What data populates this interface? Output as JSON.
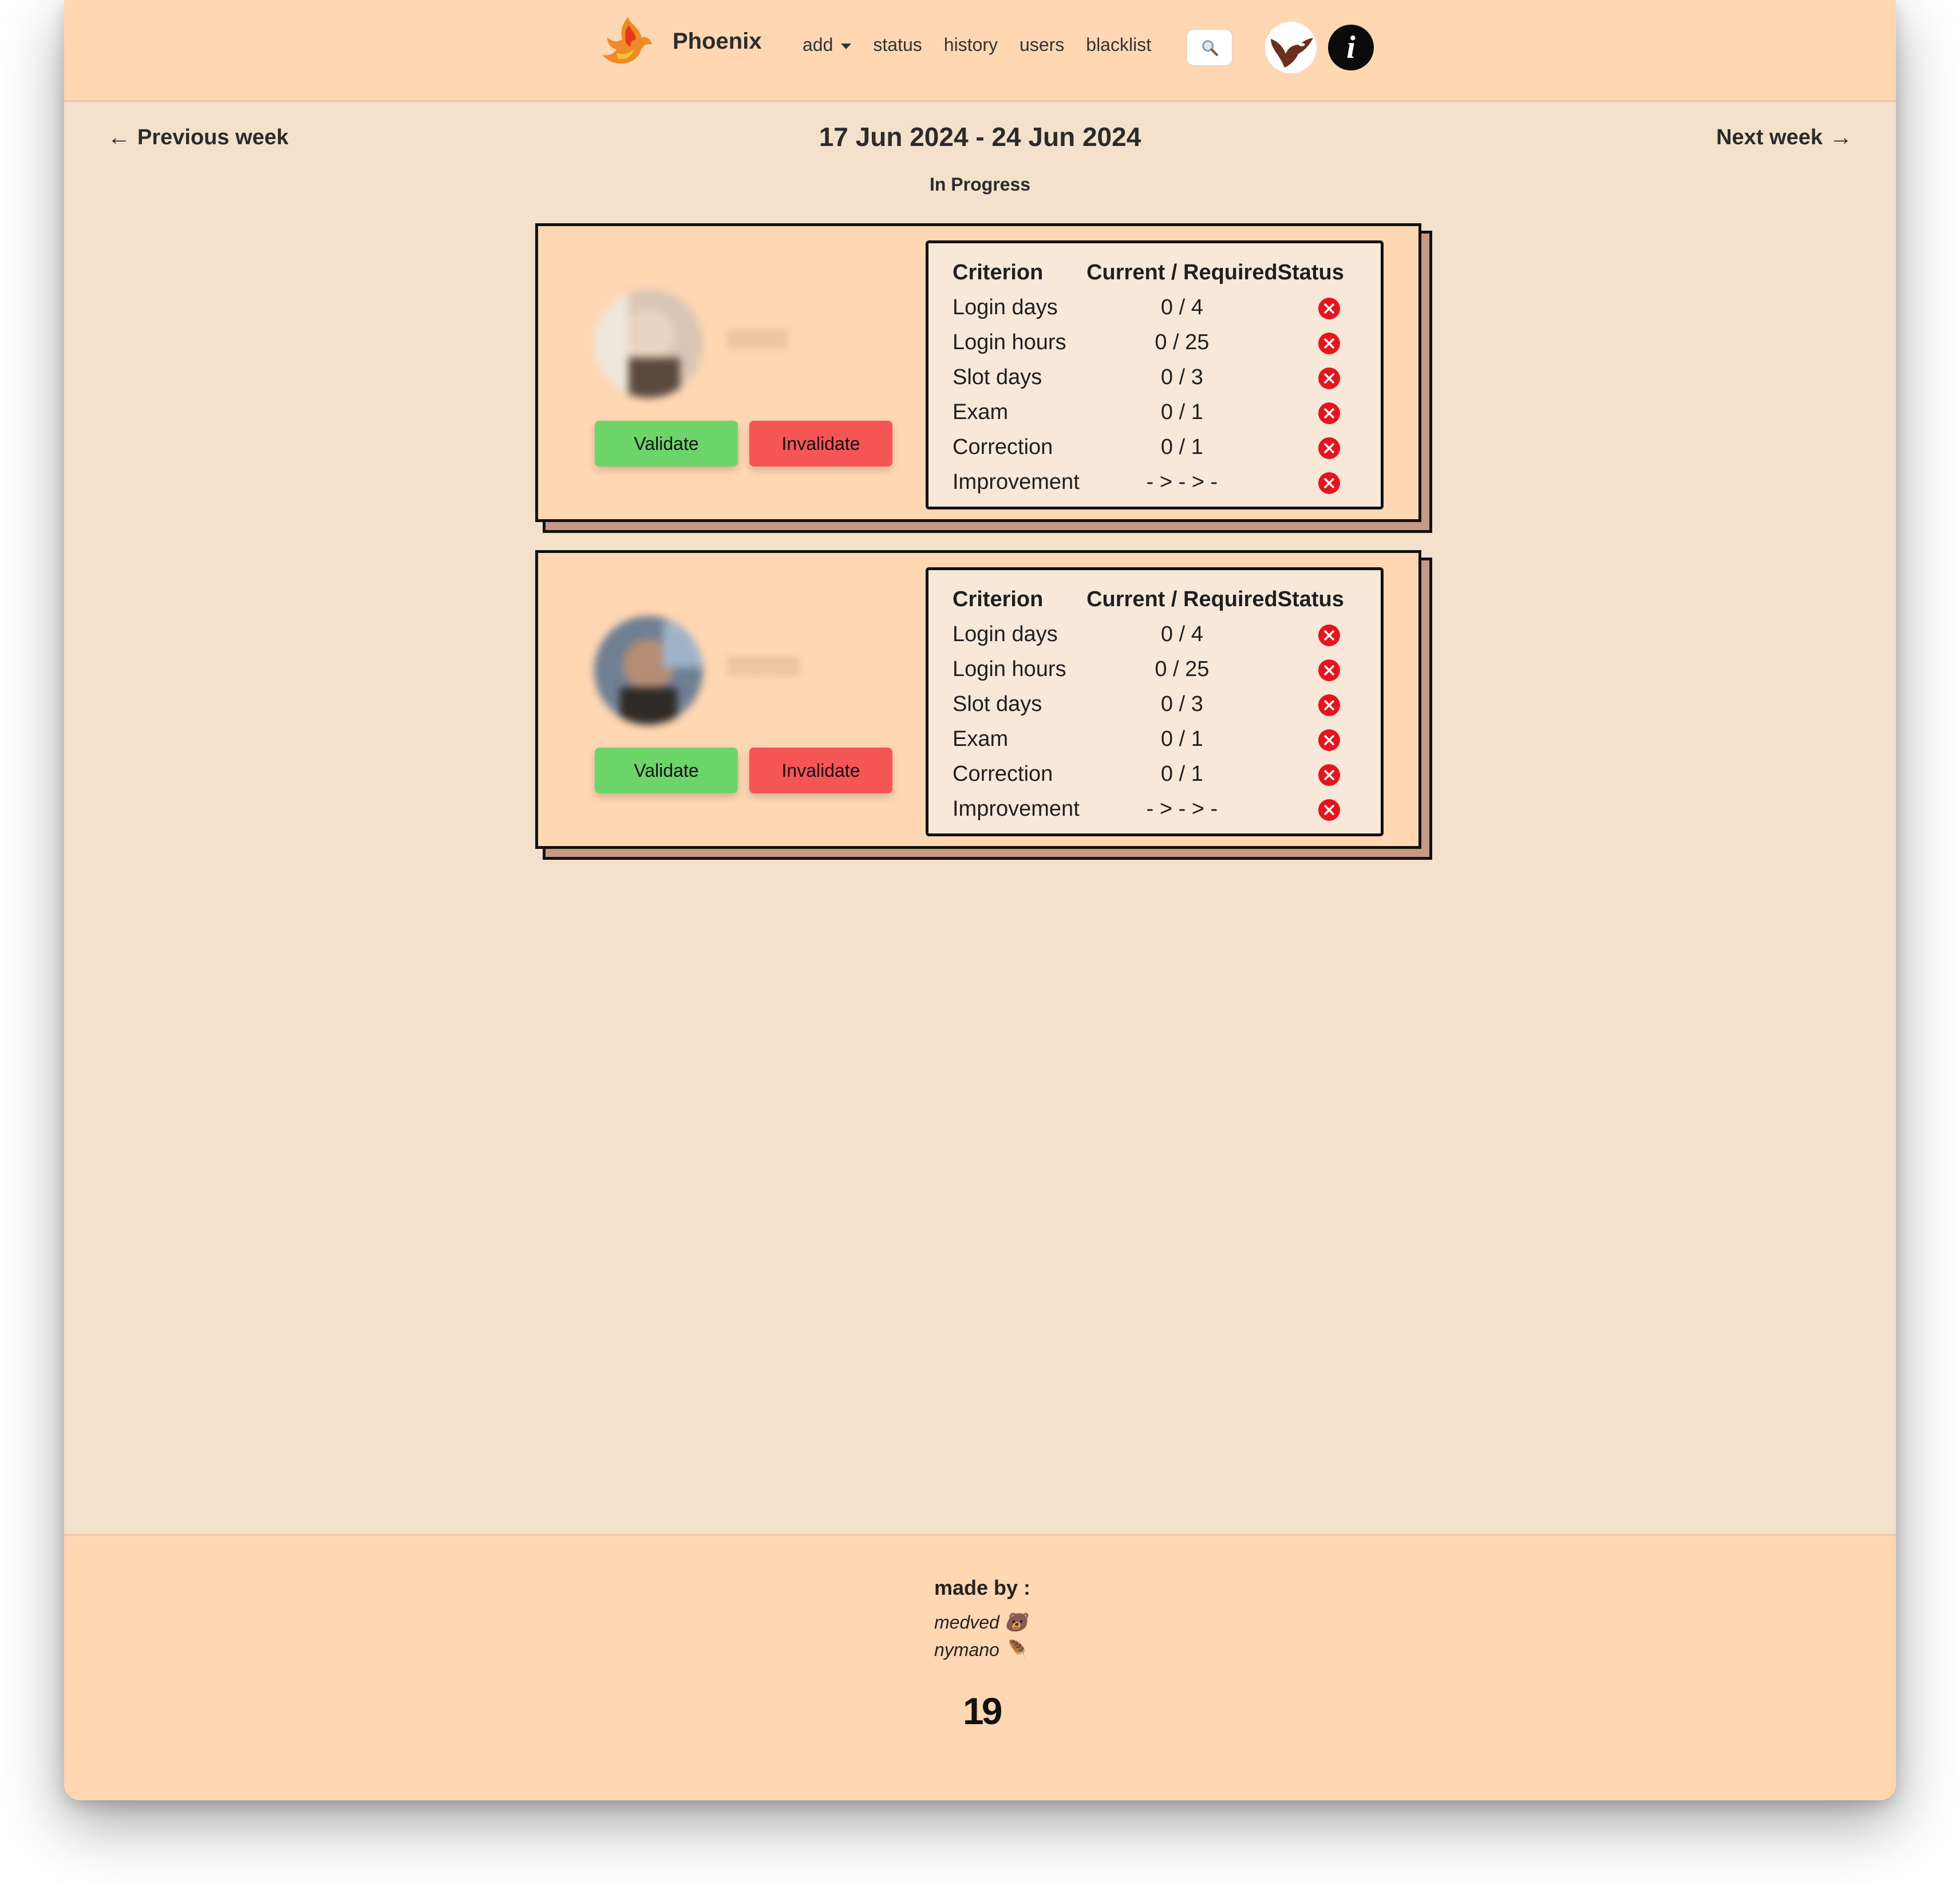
{
  "navbar": {
    "brand": "Phoenix",
    "items": [
      {
        "label": "add",
        "dropdown": true
      },
      {
        "label": "status"
      },
      {
        "label": "history"
      },
      {
        "label": "users"
      },
      {
        "label": "blacklist"
      }
    ],
    "search_icon": "search-icon",
    "profile_icon": "bird-avatar-icon",
    "info_icon": "info-icon"
  },
  "week": {
    "prev_label": "Previous week",
    "next_label": "Next week",
    "range": "17 Jun 2024 - 24 Jun 2024",
    "status": "In Progress"
  },
  "cards": [
    {
      "validate_label": "Validate",
      "invalidate_label": "Invalidate",
      "header": {
        "criterion": "Criterion",
        "current": "Current / Required",
        "status": "Status"
      },
      "rows": [
        {
          "criterion": "Login days",
          "value": "0 / 4",
          "status": "failed"
        },
        {
          "criterion": "Login hours",
          "value": "0 / 25",
          "status": "failed"
        },
        {
          "criterion": "Slot days",
          "value": "0 / 3",
          "status": "failed"
        },
        {
          "criterion": "Exam",
          "value": "0 / 1",
          "status": "failed"
        },
        {
          "criterion": "Correction",
          "value": "0 / 1",
          "status": "failed"
        },
        {
          "criterion": "Improvement",
          "value": "- > - > -",
          "status": "failed"
        }
      ]
    },
    {
      "validate_label": "Validate",
      "invalidate_label": "Invalidate",
      "header": {
        "criterion": "Criterion",
        "current": "Current / Required",
        "status": "Status"
      },
      "rows": [
        {
          "criterion": "Login days",
          "value": "0 / 4",
          "status": "failed"
        },
        {
          "criterion": "Login hours",
          "value": "0 / 25",
          "status": "failed"
        },
        {
          "criterion": "Slot days",
          "value": "0 / 3",
          "status": "failed"
        },
        {
          "criterion": "Exam",
          "value": "0 / 1",
          "status": "failed"
        },
        {
          "criterion": "Correction",
          "value": "0 / 1",
          "status": "failed"
        },
        {
          "criterion": "Improvement",
          "value": "- > - > -",
          "status": "failed"
        }
      ]
    }
  ],
  "footer": {
    "made_by": "made by :",
    "authors": [
      {
        "name": "medved",
        "emoji": "🐻"
      },
      {
        "name": "nymano",
        "emoji": "🪶"
      }
    ],
    "logo_text": "19"
  },
  "colors": {
    "navbar_bg": "#ffd7b3",
    "page_bg": "#f4e1cc",
    "validate": "#6dd46a",
    "invalidate": "#f65555",
    "fail_icon": "#e8141c"
  }
}
